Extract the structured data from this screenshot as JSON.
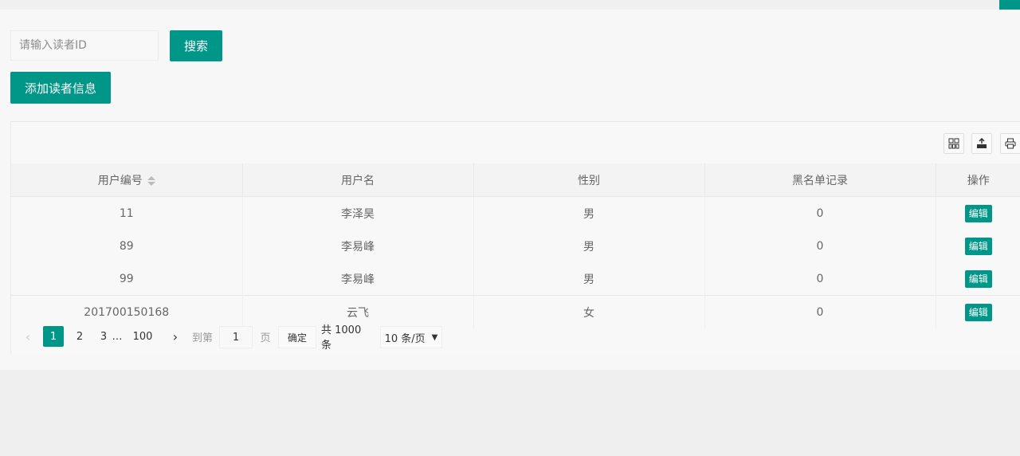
{
  "search": {
    "placeholder": "请输入读者ID",
    "button": "搜索"
  },
  "actions": {
    "add_label": "添加读者信息"
  },
  "toolbar": {
    "icons": [
      "columns-icon",
      "export-icon",
      "print-icon"
    ]
  },
  "table": {
    "columns": [
      "用户编号",
      "用户名",
      "性别",
      "黑名单记录",
      "操作"
    ],
    "rows": [
      {
        "id": "11",
        "name": "李泽昊",
        "gender": "男",
        "blacklist": "0",
        "action": "编辑"
      },
      {
        "id": "89",
        "name": "李易峰",
        "gender": "男",
        "blacklist": "0",
        "action": "编辑"
      },
      {
        "id": "99",
        "name": "李易峰",
        "gender": "男",
        "blacklist": "0",
        "action": "编辑"
      },
      {
        "id": "201700150168",
        "name": "云飞",
        "gender": "女",
        "blacklist": "0",
        "action": "编辑"
      }
    ]
  },
  "pagination": {
    "pages": [
      "1",
      "2",
      "3"
    ],
    "ellipsis": "…",
    "last": "100",
    "goto_label": "到第",
    "goto_value": "1",
    "page_unit": "页",
    "confirm": "确定",
    "total": "共 1000 条",
    "page_size": "10 条/页"
  },
  "colors": {
    "accent": "#009688"
  }
}
